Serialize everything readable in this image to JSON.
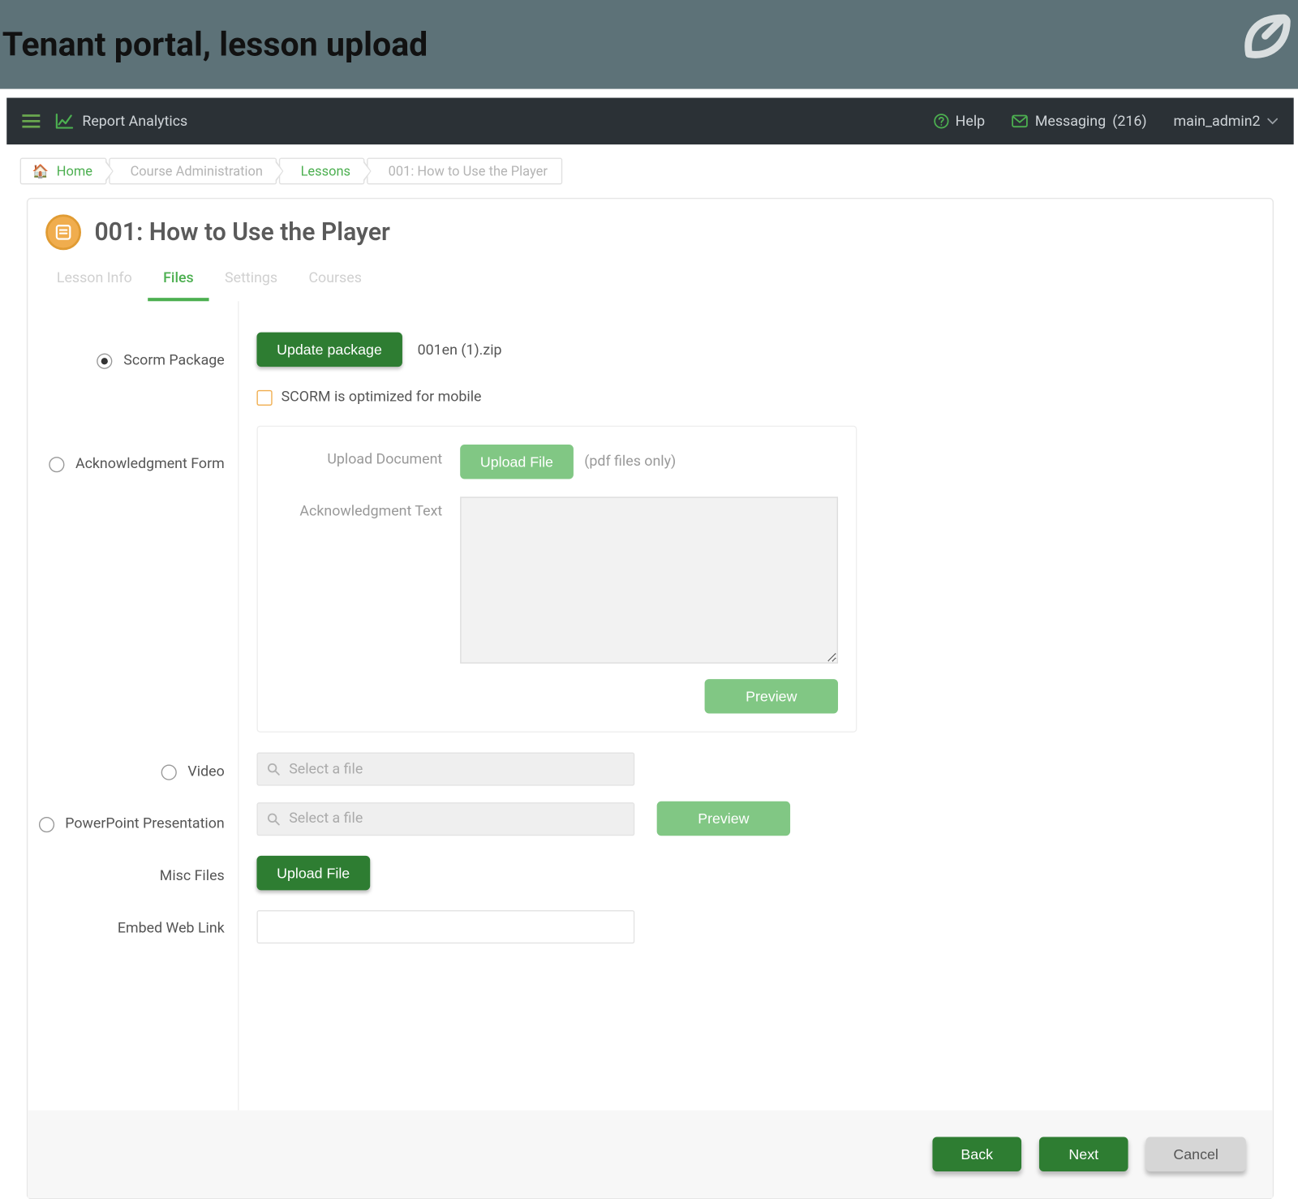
{
  "hero": {
    "title": "Tenant portal, lesson upload"
  },
  "topnav": {
    "analytics": "Report Analytics",
    "help": "Help",
    "messaging_label": "Messaging",
    "messaging_count": "(216)",
    "user": "main_admin2"
  },
  "breadcrumbs": {
    "home": "Home",
    "course_admin": "Course Administration",
    "lessons": "Lessons",
    "current": "001: How to Use the Player"
  },
  "page": {
    "title": "001: How to Use the Player",
    "tabs": {
      "lesson_info": "Lesson Info",
      "files": "Files",
      "settings": "Settings",
      "courses": "Courses"
    }
  },
  "left": {
    "scorm": "Scorm Package",
    "ack": "Acknowledgment Form",
    "video": "Video",
    "ppt": "PowerPoint Presentation",
    "misc": "Misc Files",
    "embed": "Embed Web Link"
  },
  "scorm": {
    "update_btn": "Update package",
    "filename": "001en (1).zip",
    "mobile_label": "SCORM is optimized for mobile"
  },
  "ack": {
    "upload_doc_label": "Upload Document",
    "upload_btn": "Upload File",
    "upload_hint": "(pdf files only)",
    "ack_text_label": "Acknowledgment Text",
    "preview_btn": "Preview"
  },
  "video": {
    "placeholder": "Select a file"
  },
  "ppt": {
    "placeholder": "Select a file",
    "preview_btn": "Preview"
  },
  "misc": {
    "upload_btn": "Upload File"
  },
  "footer": {
    "back": "Back",
    "next": "Next",
    "cancel": "Cancel"
  }
}
